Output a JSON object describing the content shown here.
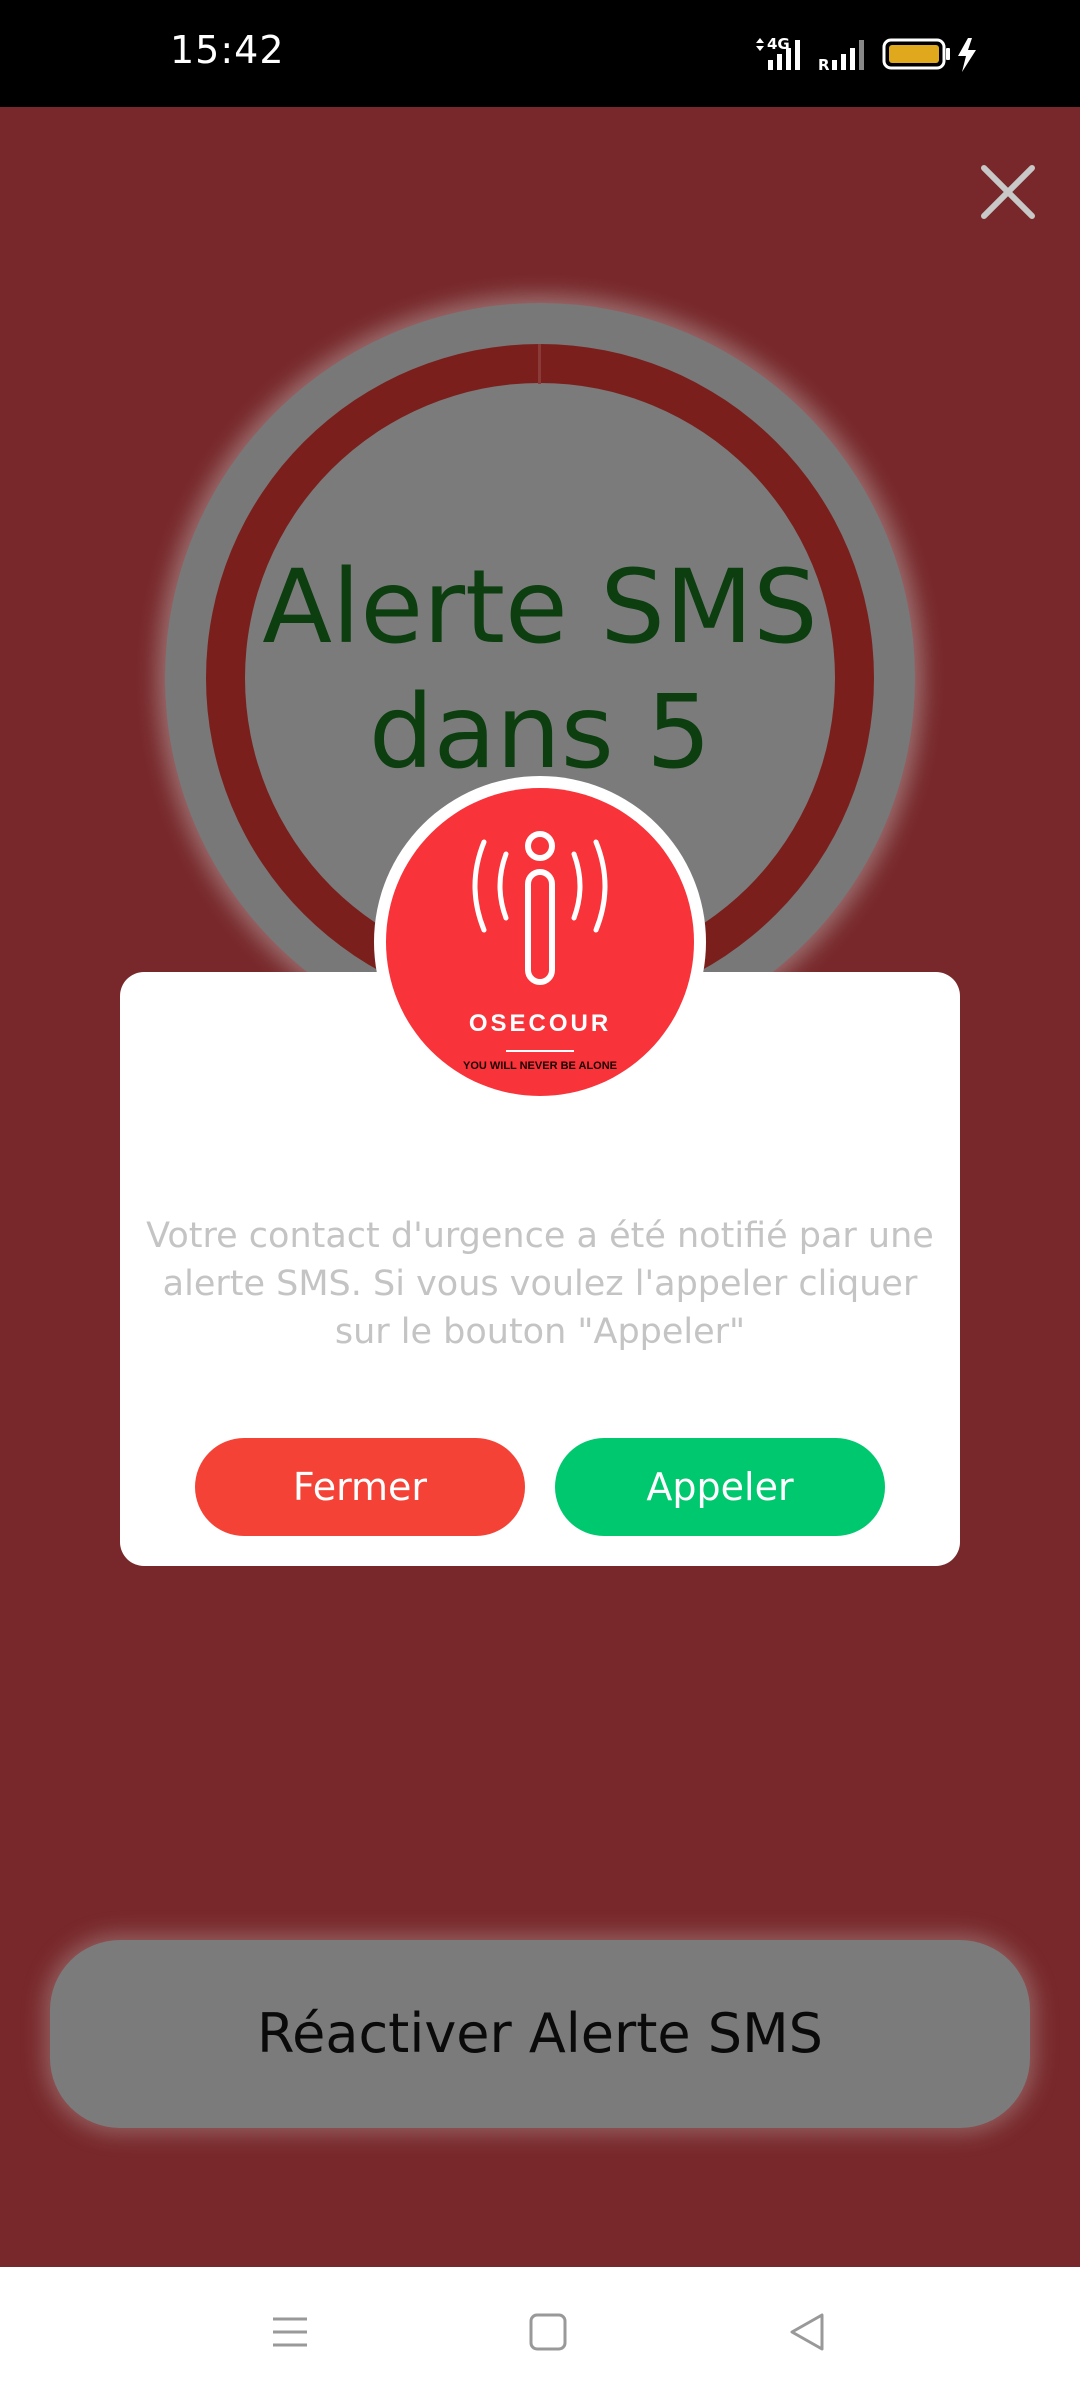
{
  "status_bar": {
    "time": "15:42",
    "network_label": "4G",
    "roaming_label": "R",
    "icons": [
      "signal-4g-icon",
      "signal-roaming-icon",
      "battery-icon",
      "charging-bolt-icon"
    ],
    "battery_color": "#e0a81c"
  },
  "countdown": {
    "line1": "Alerte SMS",
    "line2": "dans 5"
  },
  "close_icon": "close-icon",
  "dialog": {
    "logo": {
      "name": "OSECOUR",
      "tagline": "YOU WILL NEVER BE ALONE",
      "color": "#f8333a"
    },
    "message": "Votre contact d'urgence a été notifié par une alerte SMS. Si vous voulez l'appeler cliquer sur le bouton \"Appeler\"",
    "close_button_label": "Fermer",
    "call_button_label": "Appeler",
    "close_button_color": "#f44336",
    "call_button_color": "#00c86e"
  },
  "reactivate_button_label": "Réactiver Alerte SMS",
  "nav": {
    "icons": [
      "menu-icon",
      "home-icon",
      "back-icon"
    ]
  },
  "colors": {
    "background": "#78282a",
    "countdown_text": "#0c3e10",
    "ring": "#7a1f1c"
  }
}
